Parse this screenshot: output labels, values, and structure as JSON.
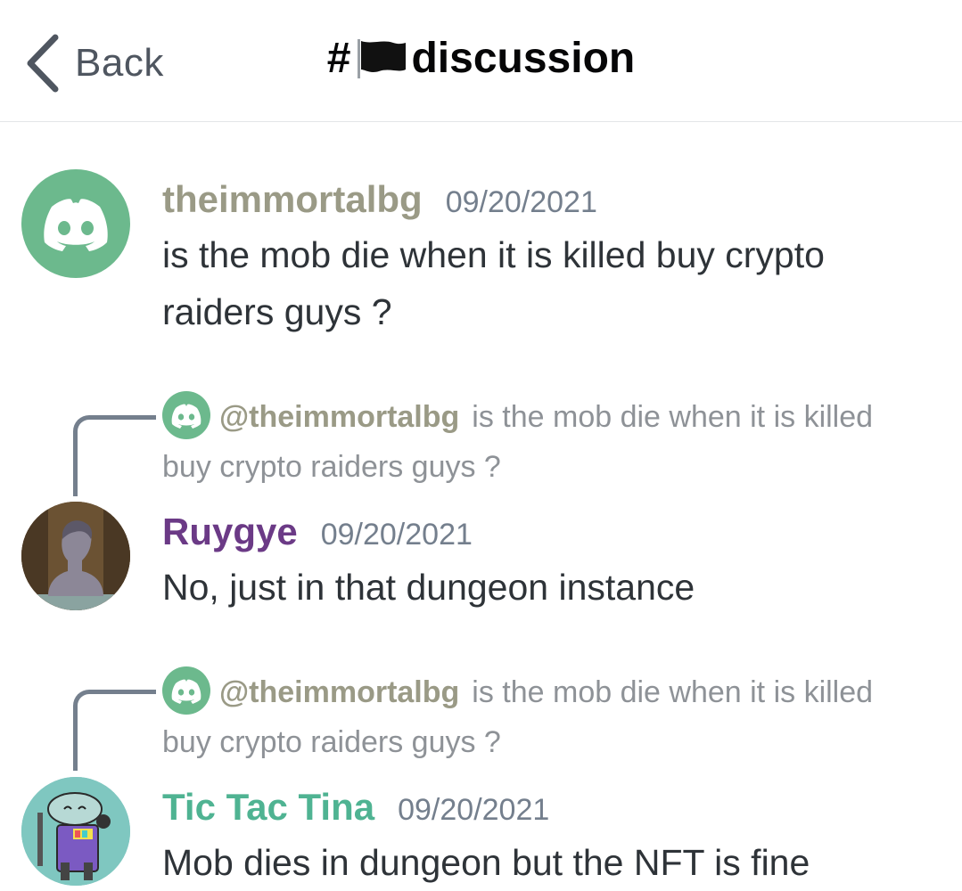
{
  "header": {
    "back_label": "Back",
    "channel_prefix": "#",
    "channel_name": "discussion",
    "flag_icon": "black-flag-icon"
  },
  "messages": [
    {
      "author": "theimmortalbg",
      "author_color": "#9a9a86",
      "timestamp": "09/20/2021",
      "content": "is the mob die when it is killed buy crypto raiders  guys ?",
      "avatar": "discord-default-avatar",
      "avatar_color": "#6cb98d"
    },
    {
      "reply": {
        "mention": "@theimmortalbg",
        "text": "is the mob die when it is killed buy crypto raiders  guys ?"
      },
      "author": "Ruygye",
      "author_color": "#6b3a86",
      "timestamp": "09/20/2021",
      "content": "No, just in that dungeon instance",
      "avatar": "classical-bust-avatar"
    },
    {
      "reply": {
        "mention": "@theimmortalbg",
        "text": "is the mob die when it is killed buy crypto raiders  guys ?"
      },
      "author": "Tic Tac Tina",
      "author_color": "#4fb392",
      "timestamp": "09/20/2021",
      "content": "Mob dies in dungeon but the NFT is fine",
      "avatar": "robot-character-avatar"
    }
  ]
}
